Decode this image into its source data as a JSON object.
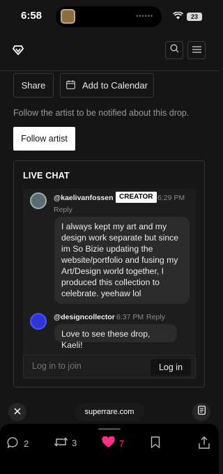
{
  "status": {
    "time": "6:58",
    "battery": "23",
    "island_dots": "••••••"
  },
  "header": {
    "logo": "diamond-logo"
  },
  "actions": {
    "share_label": "Share",
    "calendar_label": "Add to Calendar"
  },
  "follow": {
    "note": "Follow the artist to be notified about this drop.",
    "button_label": "Follow artist"
  },
  "chat": {
    "title": "LIVE CHAT",
    "messages": [
      {
        "username": "@kaelivanfossen",
        "badge": "CREATOR",
        "time": "6:29 PM",
        "reply_label": "Reply",
        "text": "I always kept my art and my design work separate but since im So Bizie updating the website/portfolio and fusing my Art/Design world together, I produced this collection to celebrate. yeehaw lol"
      },
      {
        "username": "@designcollector",
        "time": "6:37 PM",
        "reply_label": "Reply",
        "text": "Love to see these drop, Kaeli!"
      }
    ],
    "input_placeholder": "Log in to join",
    "login_label": "Log in"
  },
  "browser": {
    "url": "superrare.com"
  },
  "social": {
    "comments": "2",
    "reposts": "3",
    "likes": "7"
  },
  "colors": {
    "background": "#151515",
    "like": "#ff2e88",
    "creator_badge_bg": "#ffffff"
  }
}
